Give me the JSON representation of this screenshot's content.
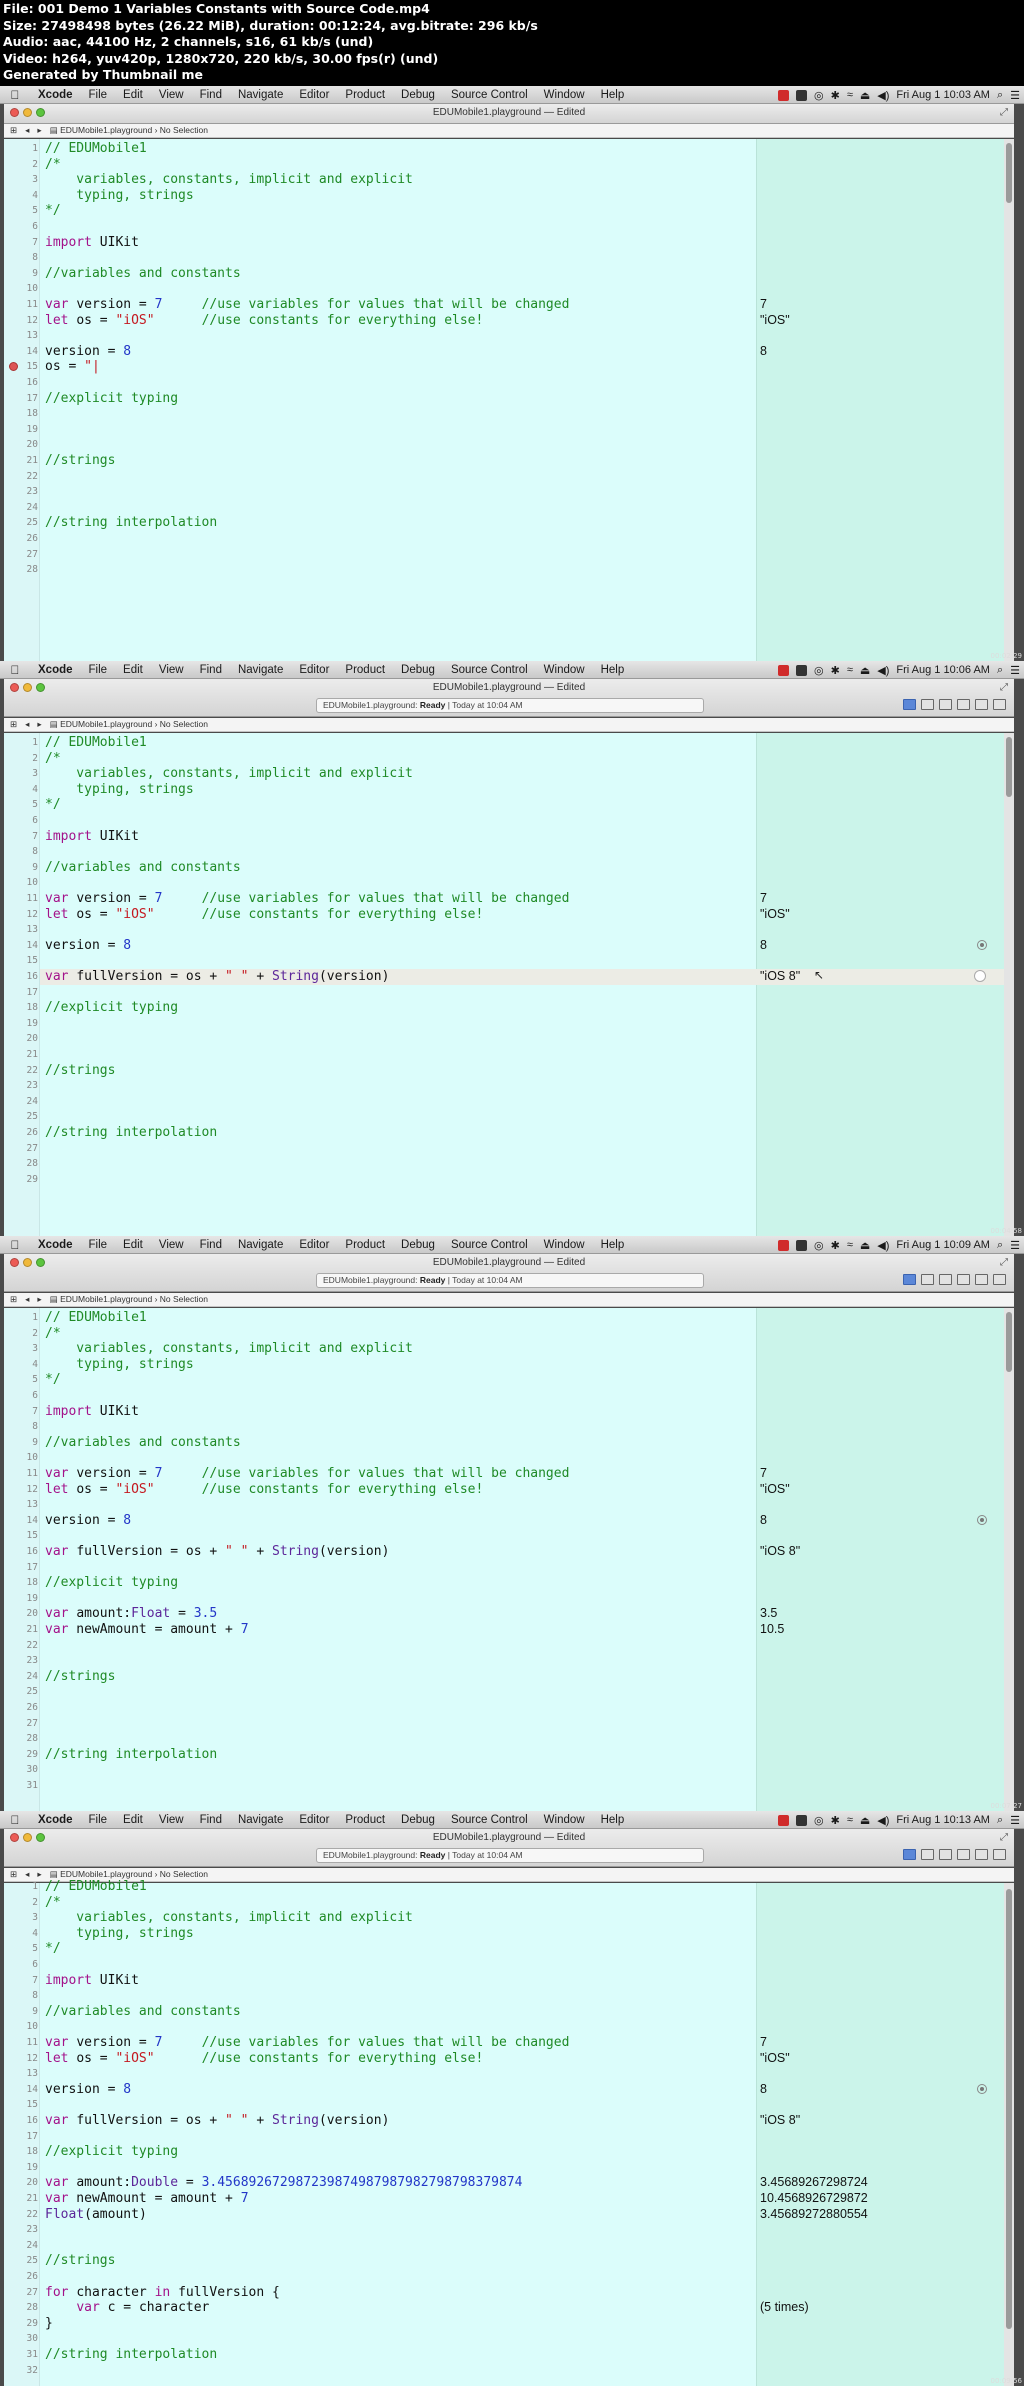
{
  "info_header": [
    "File: 001 Demo 1 Variables  Constants with Source Code.mp4",
    "Size: 27498498 bytes (26.22 MiB), duration: 00:12:24, avg.bitrate: 296 kb/s",
    "Audio: aac, 44100 Hz, 2 channels, s16, 61 kb/s (und)",
    "Video: h264, yuv420p, 1280x720, 220 kb/s, 30.00 fps(r) (und)",
    "Generated by Thumbnail me"
  ],
  "menubar": {
    "apple_icon": "apple-icon",
    "items": [
      "Xcode",
      "File",
      "Edit",
      "View",
      "Find",
      "Navigate",
      "Editor",
      "Product",
      "Debug",
      "Source Control",
      "Window",
      "Help"
    ]
  },
  "window_title": "EDUMobile1.playground — Edited",
  "status": {
    "name": "EDUMobile1.playground:",
    "state": "Ready",
    "time": "Today at 10:04 AM"
  },
  "jumpbar": {
    "file": "EDUMobile1.playground",
    "selection": "No Selection"
  },
  "frames": [
    {
      "clock": "Fri Aug 1  10:03 AM",
      "timestamp": "00:02:29",
      "lines": [
        "// EDUMobile1",
        "/*",
        "    variables, constants, implicit and explicit",
        "    typing, strings",
        "*/",
        "",
        "import UIKit",
        "",
        "//variables and constants",
        "",
        "var version = 7     //use variables for values that will be changed",
        "let os = \"iOS\"      //use constants for everything else!",
        "",
        "version = 8",
        "os = \"|",
        "",
        "//explicit typing",
        "",
        "",
        "",
        "//strings",
        "",
        "",
        "",
        "//string interpolation",
        "",
        "",
        ""
      ],
      "results": {
        "11": "7",
        "12": "\"iOS\"",
        "14": "8"
      }
    },
    {
      "clock": "Fri Aug 1  10:06 AM",
      "timestamp": "00:04:58",
      "lines": [
        "// EDUMobile1",
        "/*",
        "    variables, constants, implicit and explicit",
        "    typing, strings",
        "*/",
        "",
        "import UIKit",
        "",
        "//variables and constants",
        "",
        "var version = 7     //use variables for values that will be changed",
        "let os = \"iOS\"      //use constants for everything else!",
        "",
        "version = 8",
        "",
        "var fullVersion = os + \" \" + String(version)",
        "",
        "//explicit typing",
        "",
        "",
        "",
        "//strings",
        "",
        "",
        "",
        "//string interpolation",
        "",
        "",
        ""
      ],
      "results": {
        "11": "7",
        "12": "\"iOS\"",
        "14": "8",
        "16": "\"iOS 8\""
      }
    },
    {
      "clock": "Fri Aug 1  10:09 AM",
      "timestamp": "00:07:27",
      "lines": [
        "// EDUMobile1",
        "/*",
        "    variables, constants, implicit and explicit",
        "    typing, strings",
        "*/",
        "",
        "import UIKit",
        "",
        "//variables and constants",
        "",
        "var version = 7     //use variables for values that will be changed",
        "let os = \"iOS\"      //use constants for everything else!",
        "",
        "version = 8",
        "",
        "var fullVersion = os + \" \" + String(version)",
        "",
        "//explicit typing",
        "",
        "var amount:Float = 3.5",
        "var newAmount = amount + 7",
        "",
        "",
        "//strings",
        "",
        "",
        "",
        "",
        "//string interpolation",
        "",
        ""
      ],
      "results": {
        "11": "7",
        "12": "\"iOS\"",
        "14": "8",
        "16": "\"iOS 8\"",
        "20": "3.5",
        "21": "10.5"
      }
    },
    {
      "clock": "Fri Aug 1  10:13 AM",
      "timestamp": "00:09:56",
      "lines": [
        "// EDUMobile1",
        "/*",
        "    variables, constants, implicit and explicit",
        "    typing, strings",
        "*/",
        "",
        "import UIKit",
        "",
        "//variables and constants",
        "",
        "var version = 7     //use variables for values that will be changed",
        "let os = \"iOS\"      //use constants for everything else!",
        "",
        "version = 8",
        "",
        "var fullVersion = os + \" \" + String(version)",
        "",
        "//explicit typing",
        "",
        "var amount:Double = 3.456892672987239874987987982798798379874",
        "var newAmount = amount + 7",
        "Float(amount)",
        "",
        "",
        "//strings",
        "",
        "for character in fullVersion {",
        "    var c = character",
        "}",
        "",
        "//string interpolation",
        ""
      ],
      "results": {
        "11": "7",
        "12": "\"iOS\"",
        "14": "8",
        "16": "\"iOS 8\"",
        "20": "3.45689267298724",
        "21": "10.4568926729872",
        "22": "3.45689272880554",
        "28": "(5 times)"
      }
    }
  ],
  "colors": {
    "editor_bg": "#dbfdfb",
    "results_bg": "#cbf4ea",
    "comment": "#1f8a26",
    "keyword": "#a3128a",
    "number": "#2336c8",
    "string": "#c4181f"
  }
}
